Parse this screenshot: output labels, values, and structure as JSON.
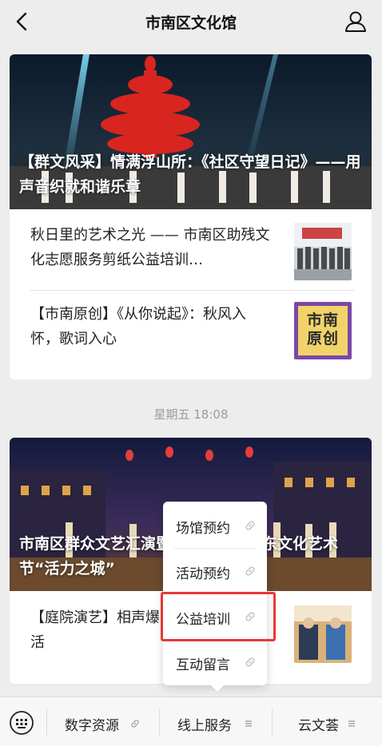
{
  "header": {
    "title": "市南区文化馆"
  },
  "card1": {
    "hero_title": "【群文风采】情满浮山所：《社区守望日记》——用声音织就和谐乐章",
    "items": [
      {
        "text": "秋日里的艺术之光 —— 市南区助残文化志愿服务剪纸公益培训…"
      },
      {
        "text": "【市南原创】《从你说起》：秋风入怀，歌词入心",
        "thumb_text": "市南原创"
      }
    ]
  },
  "timestamp": "星期五 18:08",
  "card2": {
    "hero_title": "市南区群众文艺汇演暨第三十三届山东文化艺术节“活力之城”",
    "items": [
      {
        "text": "【庭院演艺】相声爆…本周庭院演艺活"
      }
    ]
  },
  "popup": {
    "items": [
      {
        "label": "场馆预约"
      },
      {
        "label": "活动预约"
      },
      {
        "label": "公益培训"
      },
      {
        "label": "互动留言"
      }
    ]
  },
  "tabbar": {
    "tabs": [
      {
        "label": "数字资源"
      },
      {
        "label": "线上服务"
      },
      {
        "label": "云文荟"
      }
    ]
  },
  "colors": {
    "highlight": "#e53935",
    "thumb_purple": "#7a49a8",
    "thumb_yellow": "#f1d36a"
  }
}
